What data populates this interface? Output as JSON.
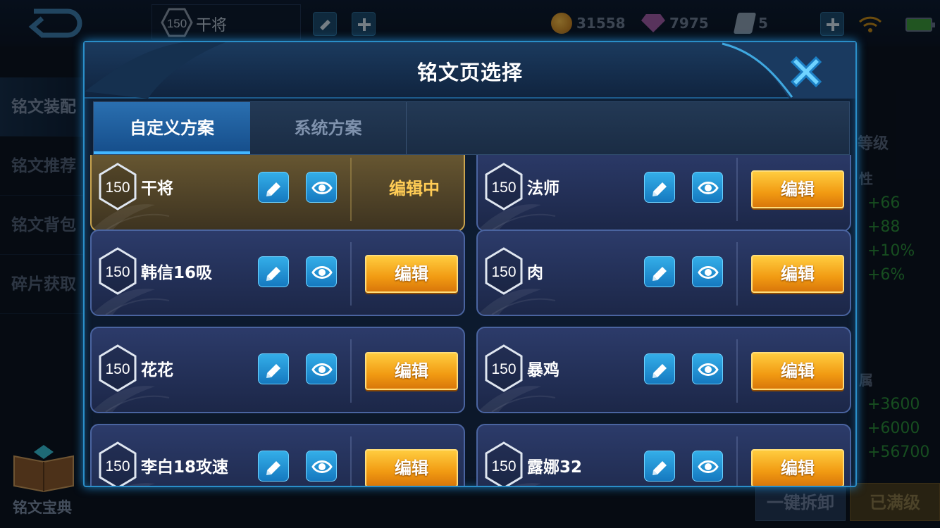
{
  "topbar": {
    "hero_level": "150",
    "hero_name": "干将",
    "gold": "31558",
    "gems": "7975",
    "tickets": "5"
  },
  "left_menu": {
    "items": [
      "铭文装配",
      "铭文推荐",
      "铭文背包",
      "碎片获取"
    ],
    "book_label": "铭文宝典"
  },
  "right_panel": {
    "level_label": "等级",
    "attr_label": "性",
    "stats_a": [
      "+66",
      "+88",
      "+10%",
      "+6%"
    ],
    "attr_label2": "属",
    "stats_b": [
      "+3600",
      "+6000",
      "+56700"
    ],
    "unload_all": "一键拆卸",
    "maxed": "已满级"
  },
  "dialog": {
    "title": "铭文页选择",
    "tabs": [
      {
        "label": "自定义方案",
        "active": true
      },
      {
        "label": "系统方案",
        "active": false
      }
    ],
    "pages": [
      {
        "level": "150",
        "name": "干将",
        "state": "编辑中",
        "editing": true
      },
      {
        "level": "150",
        "name": "法师",
        "state": "编辑",
        "editing": false
      },
      {
        "level": "150",
        "name": "韩信16吸",
        "state": "编辑",
        "editing": false
      },
      {
        "level": "150",
        "name": "肉",
        "state": "编辑",
        "editing": false
      },
      {
        "level": "150",
        "name": "花花",
        "state": "编辑",
        "editing": false
      },
      {
        "level": "150",
        "name": "暴鸡",
        "state": "编辑",
        "editing": false
      },
      {
        "level": "150",
        "name": "李白18攻速",
        "state": "编辑",
        "editing": false
      },
      {
        "level": "150",
        "name": "露娜32",
        "state": "编辑",
        "editing": false
      }
    ]
  },
  "colors": {
    "accent_blue": "#2a8ec8",
    "edit_orange": "#f19a12",
    "editing_gold": "#ffcc55",
    "stat_green": "#2b8f3b"
  },
  "icons": [
    "back-icon",
    "pencil-icon",
    "plus-icon",
    "gold-coin-icon",
    "gem-icon",
    "ticket-icon",
    "wifi-icon",
    "battery-icon",
    "close-icon",
    "rename-icon",
    "eye-icon",
    "book-icon",
    "level-hexagon-icon"
  ]
}
